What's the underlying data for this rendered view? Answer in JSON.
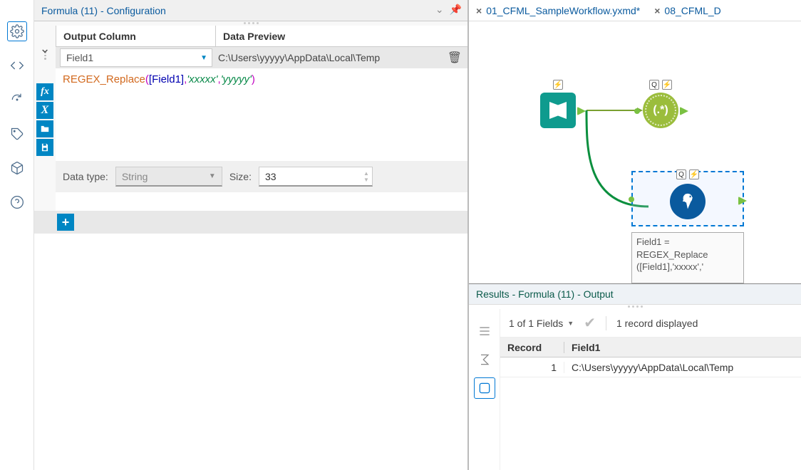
{
  "config_title": "Formula (11) - Configuration",
  "grid": {
    "col_output": "Output Column",
    "col_preview": "Data Preview",
    "field_value": "Field1",
    "preview_value": "C:\\Users\\yyyyy\\AppData\\Local\\Temp"
  },
  "expr": {
    "fn": "REGEX_Replace",
    "col": "[Field1]",
    "s1": "'xxxxx'",
    "s2": "'yyyyy'"
  },
  "type_row": {
    "label_type": "Data type:",
    "type_value": "String",
    "label_size": "Size:",
    "size_value": "33"
  },
  "tabs": {
    "t1": "01_CFML_SampleWorkflow.yxmd*",
    "t2": "08_CFML_D"
  },
  "canvas": {
    "regex_label": "(.*)",
    "formula_text_l1": "Field1 =",
    "formula_text_l2": "REGEX_Replace",
    "formula_text_l3": "([Field1],'xxxxx','"
  },
  "results": {
    "title": "Results - Formula (11) - Output",
    "fields_text": "1 of 1 Fields",
    "records_text": "1 record displayed",
    "col_record": "Record",
    "col_field": "Field1",
    "row_num": "1",
    "row_val": "C:\\Users\\yyyyy\\AppData\\Local\\Temp"
  }
}
